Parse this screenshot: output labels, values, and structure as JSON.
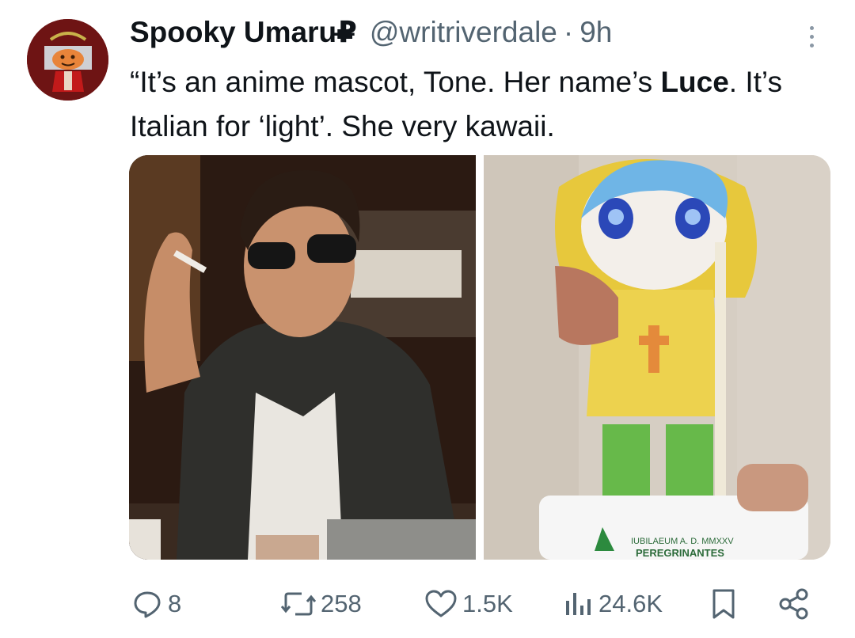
{
  "tweet": {
    "author_name": "Spooky Umaru",
    "author_glyph": "₽̶",
    "handle": "@writriverdale",
    "separator": "·",
    "time": "9h",
    "text": {
      "part1": "“It’s an anime mascot, Tone. Her name’s ",
      "bold": "Luce",
      "part2": ". It’s Italian for ‘light’. She very kawaii."
    },
    "media": {
      "pedestal_line1": "IUBILAEUM A. D. MMXXV",
      "pedestal_line2": "PEREGRINANTES"
    },
    "actions": {
      "replies": "8",
      "reposts": "258",
      "likes": "1.5K",
      "views": "24.6K"
    },
    "icons": [
      "reply-icon",
      "repost-icon",
      "like-icon",
      "views-icon",
      "bookmark-icon",
      "share-icon",
      "more-icon"
    ],
    "colors": {
      "text": "#0f1419",
      "secondary": "#536471",
      "avatar_bg": "#6e1414"
    }
  }
}
